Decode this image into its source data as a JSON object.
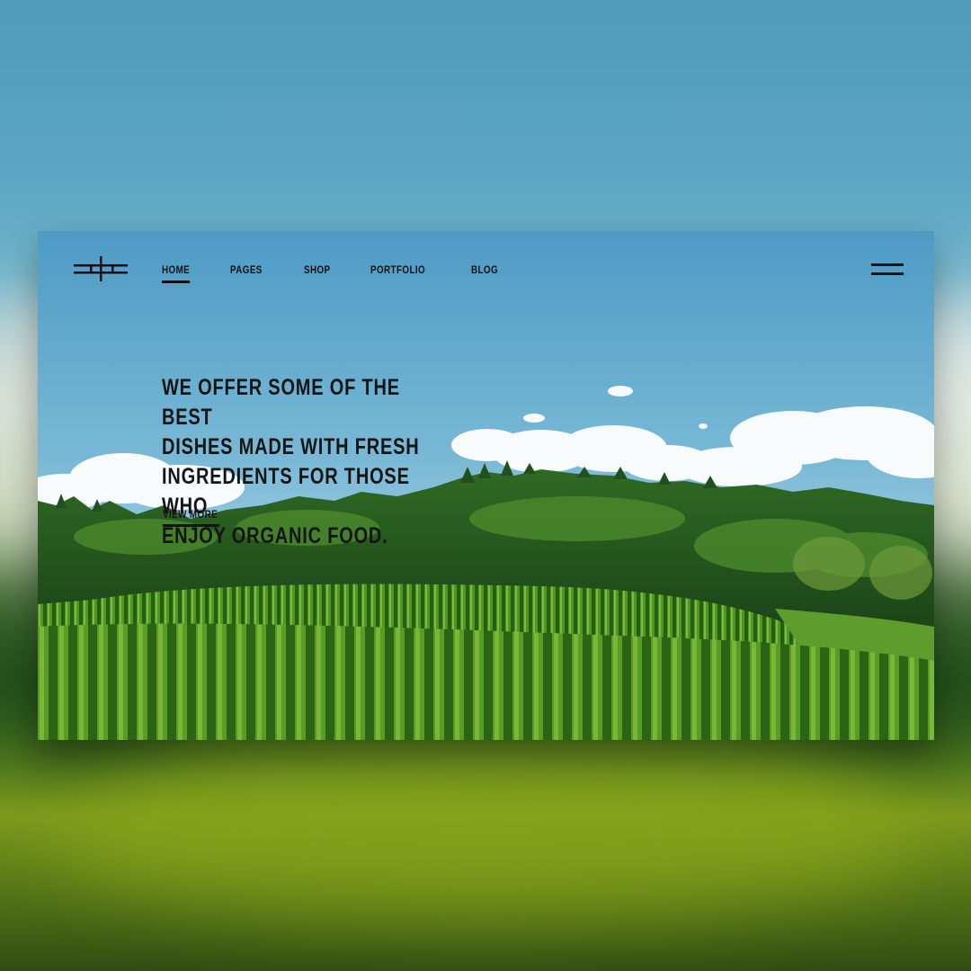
{
  "nav": {
    "items": [
      {
        "label": "HOME",
        "active": true
      },
      {
        "label": "PAGES",
        "active": false
      },
      {
        "label": "SHOP",
        "active": false
      },
      {
        "label": "PORTFOLIO",
        "active": false
      },
      {
        "label": "BLOG",
        "active": false
      }
    ],
    "logo_icon": "abstract-cross-logo-icon",
    "menu_icon": "hamburger-menu-icon"
  },
  "hero": {
    "title": "WE OFFER SOME OF THE BEST\nDISHES MADE WITH FRESH\nINGREDIENTS FOR THOSE WHO\nENJOY ORGANIC FOOD.",
    "cta_label": "VIEW MORE"
  },
  "colors": {
    "text": "#121212",
    "sky_top": "#4a9cc4",
    "sky_bottom": "#cfe6ef",
    "foliage": "#2f6d1f",
    "field": "#4f9a1c"
  }
}
